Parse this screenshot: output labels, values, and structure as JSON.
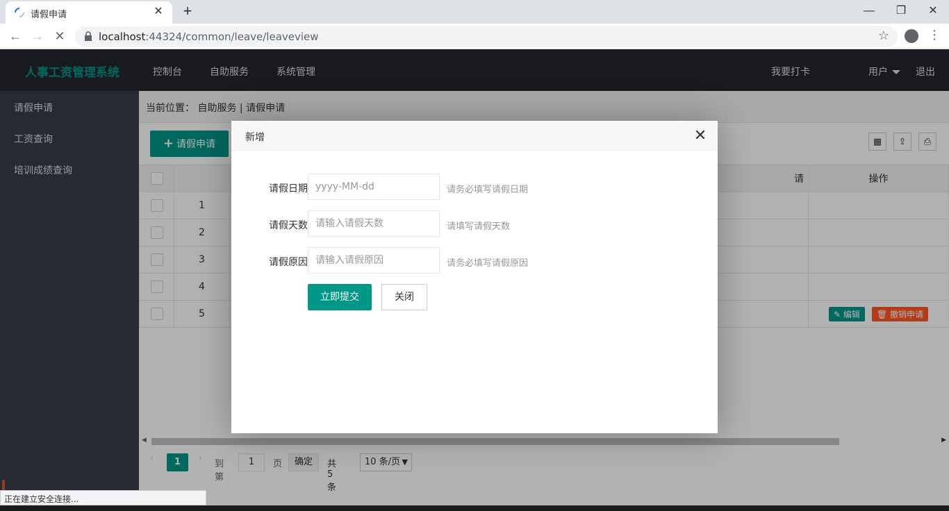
{
  "browser": {
    "tab_title": "请假申请",
    "new_tab": "+",
    "url_host": "localhost",
    "url_rest": ":44324/common/leave/leaveview",
    "status_text": "正在建立安全连接..."
  },
  "header": {
    "logo": "人事工资管理系统",
    "nav": [
      "控制台",
      "自助服务",
      "系统管理"
    ],
    "clock_in": "我要打卡",
    "user": "用户",
    "logout": "退出"
  },
  "sidebar": {
    "items": [
      {
        "label": "请假申请"
      },
      {
        "label": "工资查询"
      },
      {
        "label": "培训成绩查询"
      }
    ]
  },
  "main": {
    "breadcrumb": "当前位置： 自助服务 | 请假申请",
    "add_button": "请假申请",
    "table": {
      "partial_header": "请",
      "actions_header": "操作",
      "rows": [
        "1",
        "2",
        "3",
        "4",
        "5"
      ],
      "edit_label": "编辑",
      "cancel_label": "撤销申请"
    },
    "pager": {
      "current": "1",
      "goto_label": "到第",
      "page_input": "1",
      "page_suffix": "页",
      "confirm": "确定",
      "total": "共 5 条",
      "page_size": "10 条/页"
    }
  },
  "dialog": {
    "title": "新增",
    "fields": [
      {
        "label": "请假日期",
        "placeholder": "yyyy-MM-dd",
        "hint": "请务必填写请假日期"
      },
      {
        "label": "请假天数",
        "placeholder": "请输入请假天数",
        "hint": "请填写请假天数"
      },
      {
        "label": "请假原因",
        "placeholder": "请输入请假原因",
        "hint": "请务必填写请假原因"
      }
    ],
    "submit": "立即提交",
    "close": "关闭"
  },
  "colors": {
    "accent": "#009688",
    "danger": "#ff5722",
    "header_bg": "#23262e",
    "sidebar_bg": "#393d49"
  }
}
